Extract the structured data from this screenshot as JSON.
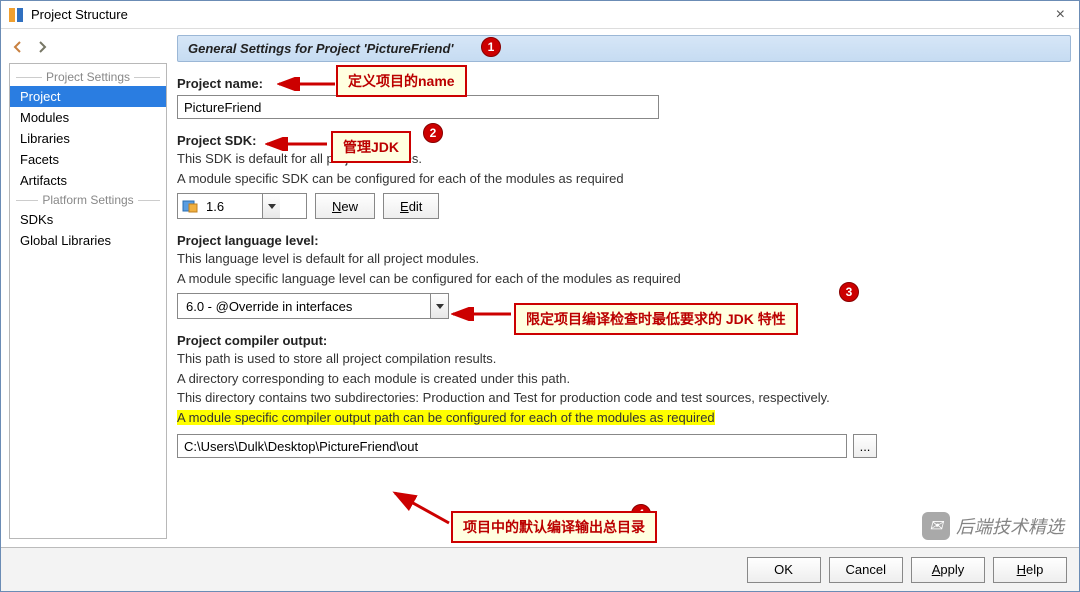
{
  "window": {
    "title": "Project Structure"
  },
  "sidebar": {
    "group1": "Project Settings",
    "group2": "Platform Settings",
    "items1": [
      "Project",
      "Modules",
      "Libraries",
      "Facets",
      "Artifacts"
    ],
    "items2": [
      "SDKs",
      "Global Libraries"
    ],
    "selected": "Project"
  },
  "header": {
    "text": "General Settings for Project 'PictureFriend'"
  },
  "project_name": {
    "label": "Project name:",
    "value": "PictureFriend"
  },
  "project_sdk": {
    "label": "Project SDK:",
    "desc1": "This SDK is default for all project modules.",
    "desc2": "A module specific SDK can be configured for each of the modules as required",
    "combo_value": "1.6",
    "new_btn": "New",
    "edit_btn": "Edit"
  },
  "lang_level": {
    "label": "Project language level:",
    "desc1": "This language level is default for all project modules.",
    "desc2": "A module specific language level can be configured for each of the modules as required",
    "combo_value": "6.0 - @Override in interfaces"
  },
  "compiler_output": {
    "label": "Project compiler output:",
    "desc1": "This path is used to store all project compilation results.",
    "desc2": "A directory corresponding to each module is created under this path.",
    "desc3": "This directory contains two subdirectories: Production and Test for production code and test sources, respectively.",
    "desc4": "A module specific compiler output path can be configured for each of the modules as required",
    "value": "C:\\Users\\Dulk\\Desktop\\PictureFriend\\out",
    "browse": "..."
  },
  "footer": {
    "ok": "OK",
    "cancel": "Cancel",
    "apply": "Apply",
    "help": "Help"
  },
  "annotations": {
    "a1": "定义项目的name",
    "a2": "管理JDK",
    "a3": "限定项目编译检查时最低要求的 JDK 特性",
    "a4": "项目中的默认编译输出总目录",
    "b1": "1",
    "b2": "2",
    "b3": "3",
    "b4": "4"
  },
  "watermark": "后端技术精选"
}
